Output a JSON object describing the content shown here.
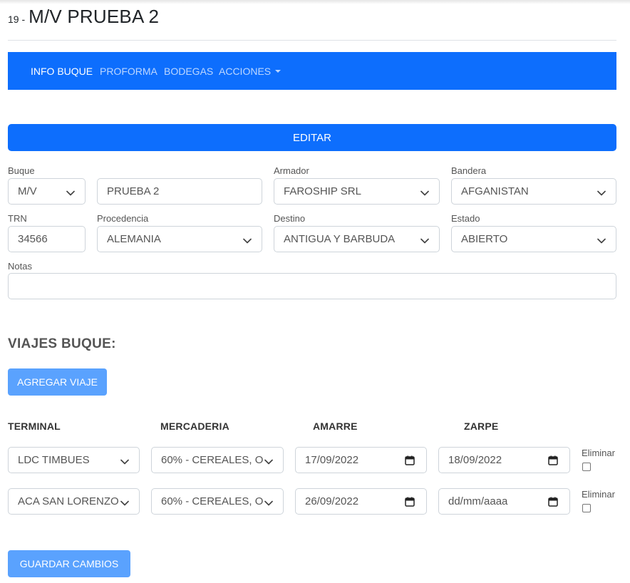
{
  "header": {
    "number": "19 -",
    "title": "M/V PRUEBA 2"
  },
  "nav": {
    "items": [
      {
        "label": "INFO BUQUE",
        "active": true
      },
      {
        "label": "PROFORMA",
        "active": false
      },
      {
        "label": "BODEGAS",
        "active": false
      },
      {
        "label": "ACCIONES",
        "active": false,
        "dropdown": true
      }
    ]
  },
  "edit_button": "EDITAR",
  "form": {
    "buque_label": "Buque",
    "buque_prefix": "M/V",
    "buque_name": "PRUEBA 2",
    "armador_label": "Armador",
    "armador": "FAROSHIP SRL",
    "bandera_label": "Bandera",
    "bandera": "AFGANISTAN",
    "trn_label": "TRN",
    "trn": "34566",
    "procedencia_label": "Procedencia",
    "procedencia": "ALEMANIA",
    "destino_label": "Destino",
    "destino": "ANTIGUA Y BARBUDA",
    "estado_label": "Estado",
    "estado": "ABIERTO",
    "notas_label": "Notas",
    "notas": ""
  },
  "viajes": {
    "heading": "VIAJES BUQUE:",
    "add_button": "AGREGAR VIAJE",
    "columns": {
      "terminal": "TERMINAL",
      "mercaderia": "MERCADERIA",
      "amarre": "AMARRE",
      "zarpe": "ZARPE"
    },
    "rows": [
      {
        "terminal": "LDC TIMBUES",
        "mercaderia": "60% - CEREALES, O",
        "amarre": "17/09/2022",
        "zarpe": "18/09/2022",
        "eliminar_label": "Eliminar",
        "eliminar": false
      },
      {
        "terminal": "ACA SAN LORENZO",
        "mercaderia": "60% - CEREALES, O",
        "amarre": "26/09/2022",
        "zarpe": "dd/mm/aaaa",
        "eliminar_label": "Eliminar",
        "eliminar": false
      }
    ]
  },
  "save_button": "GUARDAR CAMBIOS",
  "colors": {
    "primary": "#0d6efd",
    "primary_light": "#5aa2fe",
    "border": "#ced4da"
  },
  "icons": {
    "select": "chevron-down-icon",
    "date": "calendar-icon"
  }
}
